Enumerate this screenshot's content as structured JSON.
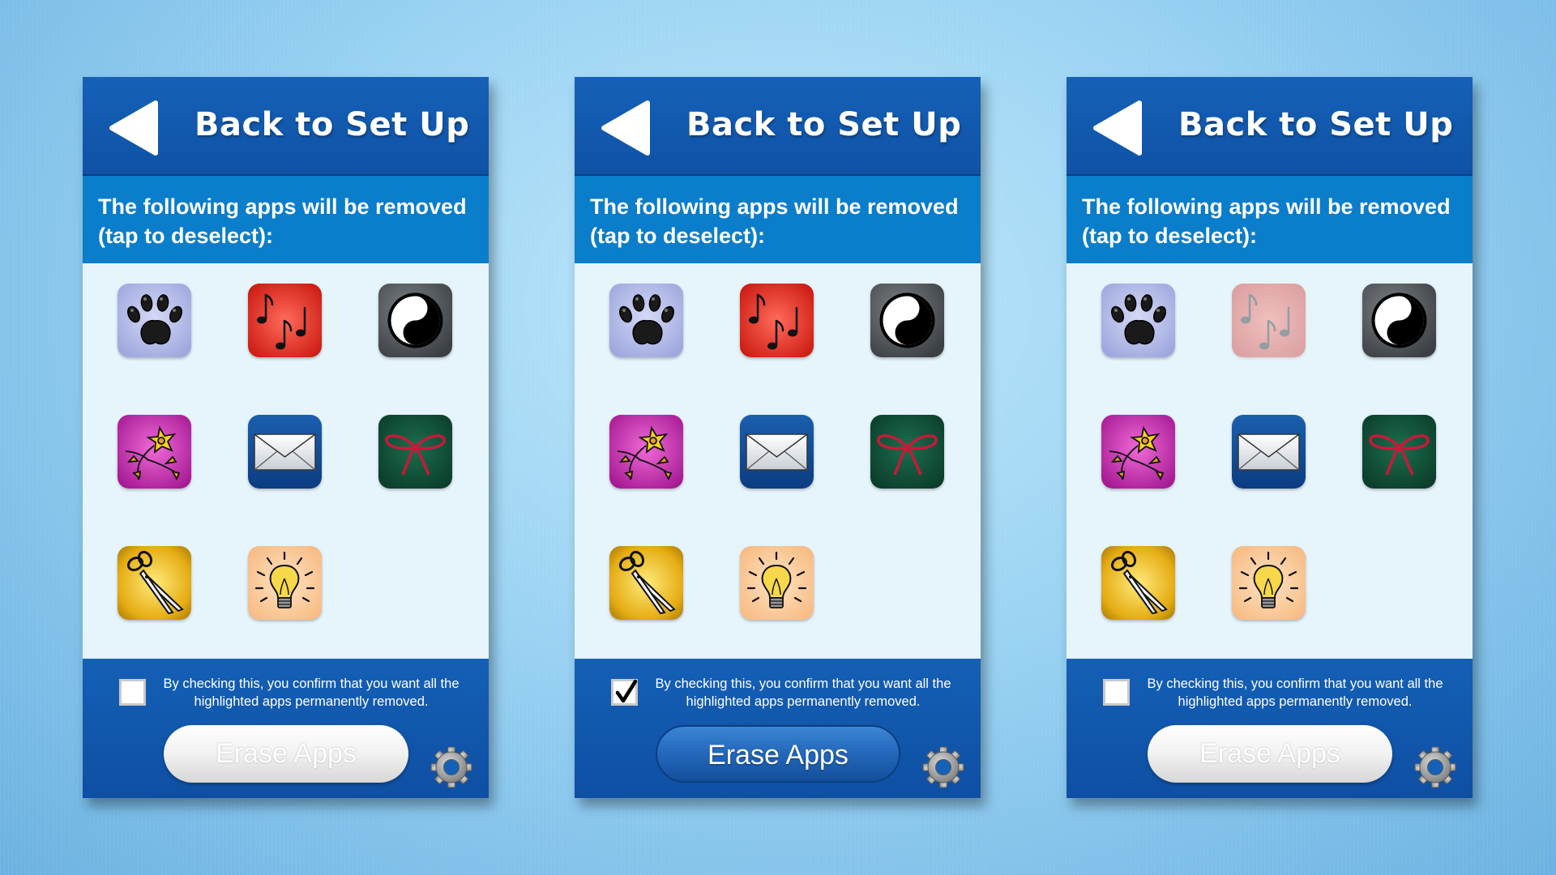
{
  "panels": [
    {
      "header_title": "Back to Set Up",
      "instruction": "The following apps will be removed (tap to deselect):",
      "confirm_text": "By checking this, you confirm that you want all the highlighted apps permanently removed.",
      "checked": false,
      "erase_label": "Erase Apps",
      "erase_enabled": false,
      "apps": [
        {
          "icon": "paw-print-icon",
          "selected": true
        },
        {
          "icon": "music-notes-icon",
          "selected": true
        },
        {
          "icon": "yin-yang-icon",
          "selected": true
        },
        {
          "icon": "flower-icon",
          "selected": true
        },
        {
          "icon": "envelope-icon",
          "selected": true
        },
        {
          "icon": "ribbon-bow-icon",
          "selected": true
        },
        {
          "icon": "scissors-icon",
          "selected": true
        },
        {
          "icon": "light-bulb-icon",
          "selected": true
        }
      ]
    },
    {
      "header_title": "Back to Set Up",
      "instruction": "The following apps will be removed (tap to deselect):",
      "confirm_text": "By checking this, you confirm that you want all the highlighted apps permanently removed.",
      "checked": true,
      "erase_label": "Erase Apps",
      "erase_enabled": true,
      "apps": [
        {
          "icon": "paw-print-icon",
          "selected": true
        },
        {
          "icon": "music-notes-icon",
          "selected": true
        },
        {
          "icon": "yin-yang-icon",
          "selected": true
        },
        {
          "icon": "flower-icon",
          "selected": true
        },
        {
          "icon": "envelope-icon",
          "selected": true
        },
        {
          "icon": "ribbon-bow-icon",
          "selected": true
        },
        {
          "icon": "scissors-icon",
          "selected": true
        },
        {
          "icon": "light-bulb-icon",
          "selected": true
        }
      ]
    },
    {
      "header_title": "Back to Set Up",
      "instruction": "The following apps will be removed (tap to deselect):",
      "confirm_text": "By checking this, you confirm that you want all the highlighted apps permanently removed.",
      "checked": false,
      "erase_label": "Erase Apps",
      "erase_enabled": false,
      "apps": [
        {
          "icon": "paw-print-icon",
          "selected": true
        },
        {
          "icon": "music-notes-icon",
          "selected": false
        },
        {
          "icon": "yin-yang-icon",
          "selected": true
        },
        {
          "icon": "flower-icon",
          "selected": true
        },
        {
          "icon": "envelope-icon",
          "selected": true
        },
        {
          "icon": "ribbon-bow-icon",
          "selected": true
        },
        {
          "icon": "scissors-icon",
          "selected": true
        },
        {
          "icon": "light-bulb-icon",
          "selected": true
        }
      ]
    }
  ],
  "colors": {
    "header_blue": "#1561b7",
    "subheader_blue": "#0a7dcb",
    "content_bg": "#e6f4fc",
    "background": "#9bd3f3"
  }
}
